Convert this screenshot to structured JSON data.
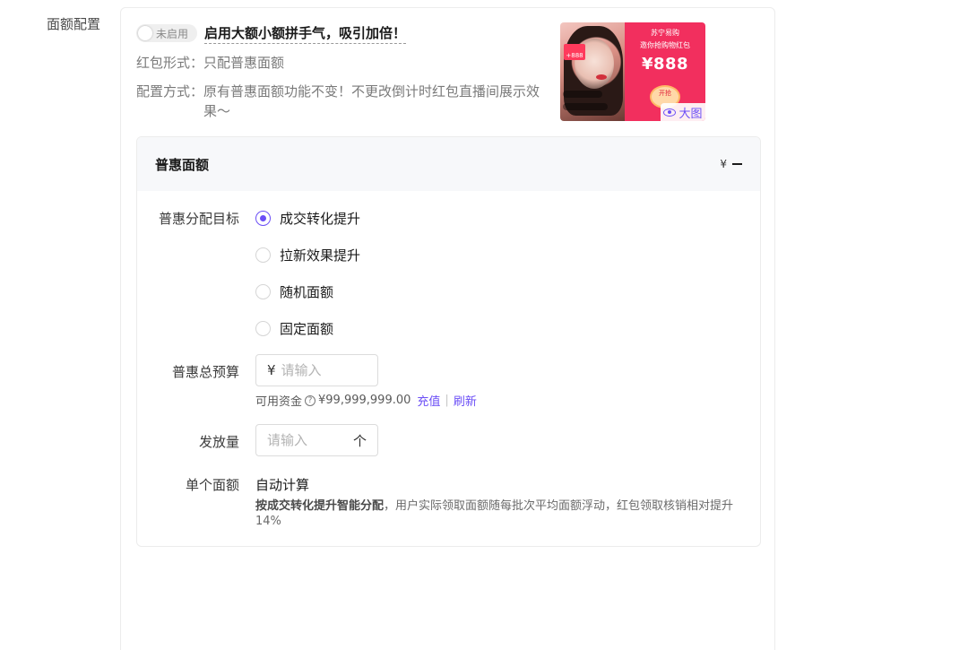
{
  "section": {
    "label": "面额配置"
  },
  "header": {
    "toggle_label": "未启用",
    "headline": "启用大额小额拼手气，吸引加倍！",
    "form_key": "红包形式：",
    "form_value": "只配普惠面额",
    "method_key": "配置方式：",
    "method_value": "原有普惠面额功能不变！不更改倒计时红包直播间展示效果～"
  },
  "preview": {
    "brand": "苏宁易购",
    "invite": "邀你抢购物红包",
    "amount": "¥888",
    "coin_text": "开抢",
    "tag": "+888",
    "big_image_label": "大图"
  },
  "card": {
    "title": "普惠面额",
    "currency_mark": "¥"
  },
  "form": {
    "target_label": "普惠分配目标",
    "options": [
      {
        "label": "成交转化提升",
        "checked": true
      },
      {
        "label": "拉新效果提升",
        "checked": false
      },
      {
        "label": "随机面额",
        "checked": false
      },
      {
        "label": "固定面额",
        "checked": false
      }
    ],
    "budget_label": "普惠总预算",
    "budget_currency": "¥",
    "budget_placeholder": "请输入",
    "funds_label": "可用资金",
    "funds_amount": "¥99,999,999.00",
    "recharge": "充值",
    "refresh": "刷新",
    "qty_label": "发放量",
    "qty_placeholder": "请输入",
    "qty_unit": "个",
    "single_label": "单个面额",
    "single_value": "自动计算",
    "desc_bold": "按成交转化提升智能分配",
    "desc_rest": "，用户实际领取面额随每批次平均面额浮动，红包领取核销相对提升14%"
  },
  "colors": {
    "accent": "#6b4ef6",
    "preview_red": "#f22f5e"
  },
  "icons": {
    "eye": "eye-icon",
    "help": "help-icon",
    "collapse": "minus-icon"
  }
}
